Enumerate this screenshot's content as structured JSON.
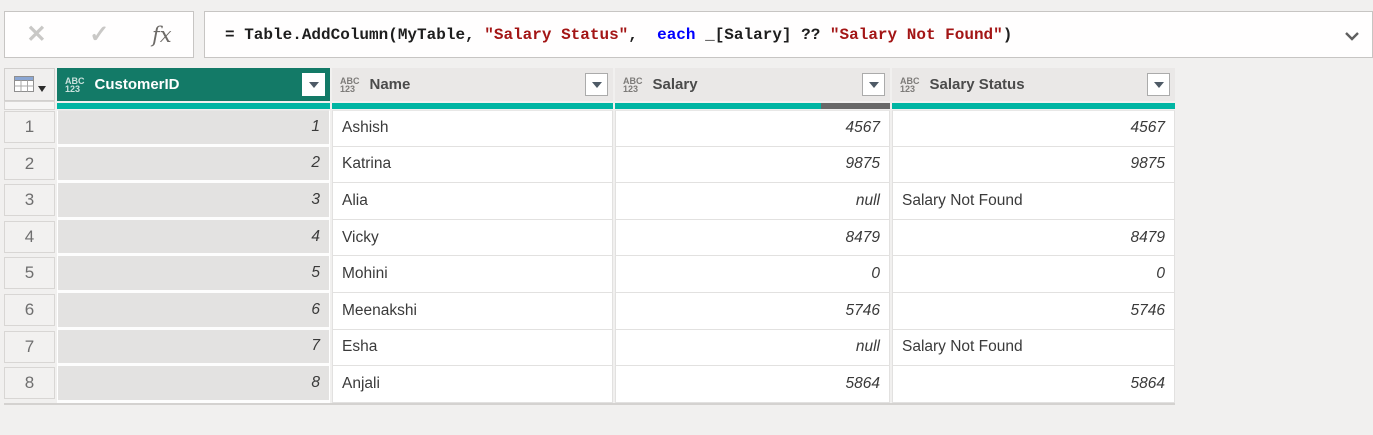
{
  "formula_bar": {
    "cancel_label": "✕",
    "confirm_label": "✓",
    "fx_label": "fx",
    "segments": [
      {
        "text": "= Table.AddColumn(MyTable, ",
        "kind": "default"
      },
      {
        "text": "\"Salary Status\"",
        "kind": "string"
      },
      {
        "text": ",  ",
        "kind": "default"
      },
      {
        "text": "each",
        "kind": "keyword"
      },
      {
        "text": " _[Salary] ?? ",
        "kind": "default"
      },
      {
        "text": "\"Salary Not Found\"",
        "kind": "string"
      },
      {
        "text": ")",
        "kind": "default"
      }
    ]
  },
  "table": {
    "type_badge": {
      "line1": "ABC",
      "line2": "123"
    },
    "columns": [
      {
        "label": "CustomerID",
        "selected": true,
        "quality_valid_pct": 100,
        "quality_empty_pct": 0
      },
      {
        "label": "Name",
        "selected": false,
        "quality_valid_pct": 100,
        "quality_empty_pct": 0
      },
      {
        "label": "Salary",
        "selected": false,
        "quality_valid_pct": 75,
        "quality_empty_pct": 25
      },
      {
        "label": "Salary Status",
        "selected": false,
        "quality_valid_pct": 100,
        "quality_empty_pct": 0
      }
    ],
    "rows": [
      {
        "num": "1",
        "id": "1",
        "name": "Ashish",
        "salary": "4567",
        "status": "4567"
      },
      {
        "num": "2",
        "id": "2",
        "name": "Katrina",
        "salary": "9875",
        "status": "9875"
      },
      {
        "num": "3",
        "id": "3",
        "name": "Alia",
        "salary": "null",
        "status": "Salary Not Found"
      },
      {
        "num": "4",
        "id": "4",
        "name": "Vicky",
        "salary": "8479",
        "status": "8479"
      },
      {
        "num": "5",
        "id": "5",
        "name": "Mohini",
        "salary": "0",
        "status": "0"
      },
      {
        "num": "6",
        "id": "6",
        "name": "Meenakshi",
        "salary": "5746",
        "status": "5746"
      },
      {
        "num": "7",
        "id": "7",
        "name": "Esha",
        "salary": "null",
        "status": "Salary Not Found"
      },
      {
        "num": "8",
        "id": "8",
        "name": "Anjali",
        "salary": "5864",
        "status": "5864"
      }
    ]
  },
  "colors": {
    "selected_header_bg": "#137a67",
    "plain_header_bg": "#eae8e7",
    "quality_bar_valid": "#00b5a3",
    "quality_bar_empty": "#686868",
    "code_default": "#1e1e1e",
    "code_string": "#a31515",
    "code_keyword": "#0000ff",
    "selected_column_cell_bg": "#e3e2e1",
    "page_bg": "#f1f0ef"
  }
}
